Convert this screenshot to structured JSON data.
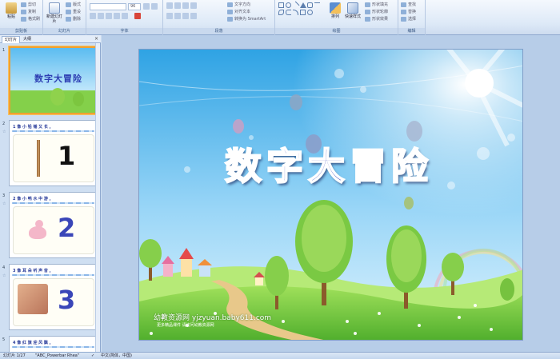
{
  "ribbon": {
    "clipboard": {
      "label": "剪贴板",
      "paste": "粘贴",
      "cut": "剪切",
      "copy": "复制",
      "format_painter": "格式刷"
    },
    "slides": {
      "label": "幻灯片",
      "new_slide": "新建幻灯片",
      "layout": "版式",
      "reset": "重设",
      "delete": "删除"
    },
    "font": {
      "label": "字体",
      "font_name": "",
      "font_size": "96"
    },
    "paragraph": {
      "label": "段落",
      "text_direction": "文字方向",
      "align_text": "对齐文本",
      "smartart": "转换为 SmartArt"
    },
    "drawing": {
      "label": "绘图",
      "arrange": "排列",
      "quick_styles": "快速样式",
      "shape_fill": "形状填充",
      "shape_outline": "形状轮廓",
      "shape_effects": "形状效果"
    },
    "editing": {
      "label": "编辑",
      "find": "查找",
      "replace": "替换",
      "select": "选择"
    }
  },
  "pane": {
    "tabs": [
      "幻灯片",
      "大纲"
    ],
    "close": "×",
    "thumbnails": [
      {
        "num": "1",
        "anim": "",
        "title": "数字大冒险"
      },
      {
        "num": "2",
        "anim": "☆",
        "title": "1 像 小 铅 锤 又 长 ,",
        "digit": "1",
        "digit_color": "#111111"
      },
      {
        "num": "3",
        "anim": "☆",
        "title": "2 像 小 鸭 水 中 游 ,",
        "digit": "2",
        "digit_color": "#3a46b8"
      },
      {
        "num": "4",
        "anim": "☆",
        "title": "3 像 耳 朵 听 声 音 ,",
        "digit": "3",
        "digit_color": "#3a46b8"
      },
      {
        "num": "5",
        "anim": "☆",
        "title": "4 像 红 旗 迎 风 飘 ,"
      }
    ]
  },
  "slide": {
    "title": "数字大冒险",
    "watermark": "幼教资源网 yjzyuan.baby611.com",
    "watermark_sub": "更多精品课件 请访问幼教资源网"
  },
  "status": {
    "slide_info": "幻灯片 1/27",
    "theme": "\"ABC_Powerbar Rhea\"",
    "check_icon": "spellcheck-icon",
    "language": "中文(简体，中国)"
  },
  "colors": {
    "accent": "#f0a030",
    "title_fill": "#2f3fb5",
    "sky_top": "#4ab3ea",
    "grass": "#7ccd3a"
  }
}
